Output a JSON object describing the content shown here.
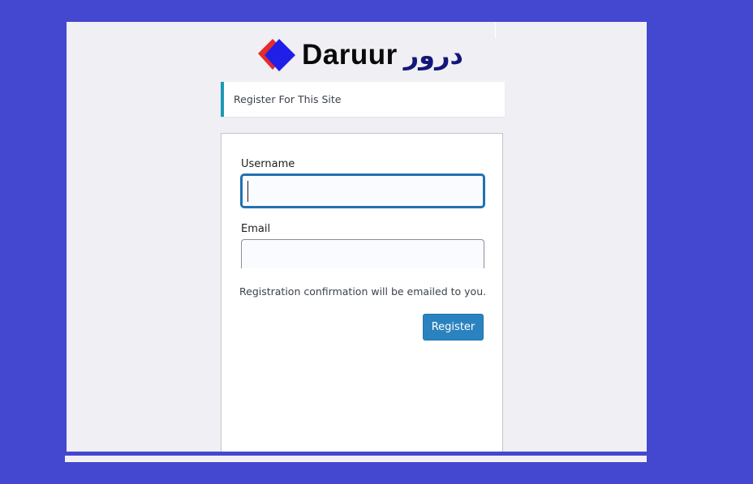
{
  "brand": {
    "name": "Daruur",
    "name_arabic": "درور"
  },
  "notice": {
    "text": "Register For This Site"
  },
  "form": {
    "username_label": "Username",
    "username_value": "",
    "email_label": "Email",
    "email_value": "",
    "confirmation_text": "Registration confirmation will be emailed to you.",
    "register_label": "Register"
  },
  "colors": {
    "background": "#4447cf",
    "accent": "#2a83be",
    "notice_border": "#1d9ab5",
    "logo_red": "#e52b2b",
    "logo_blue": "#1f1fe8"
  }
}
